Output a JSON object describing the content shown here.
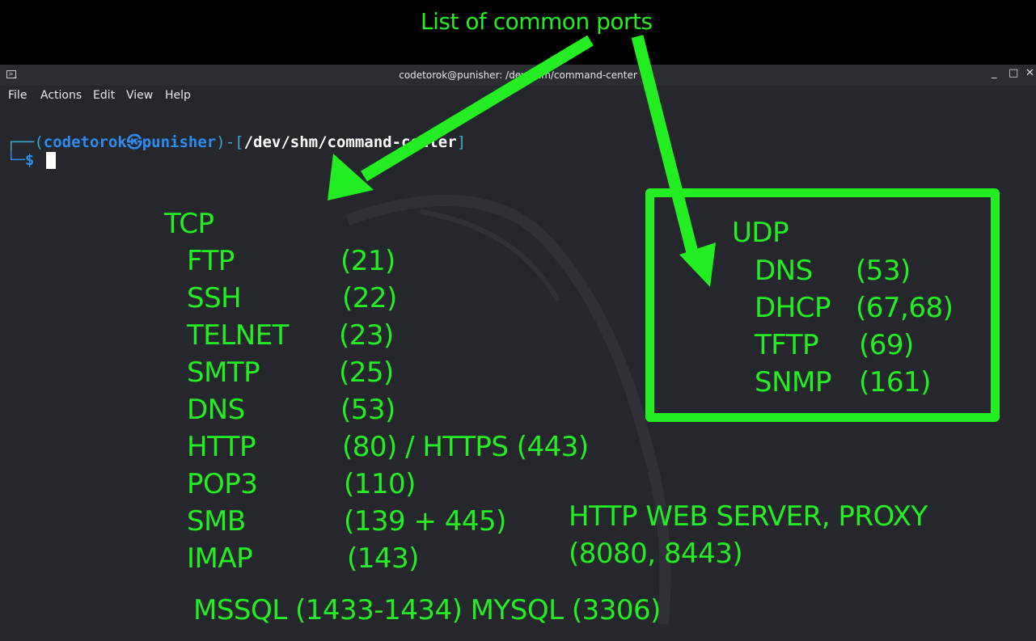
{
  "caption": "List of common ports",
  "window": {
    "title": "codetorok@punisher: /dev/shm/command-center",
    "controls": [
      "_",
      "□",
      "✕"
    ]
  },
  "menu": [
    "File",
    "Actions",
    "Edit",
    "View",
    "Help"
  ],
  "prompt": {
    "open": "┌──(",
    "user": "codetorok",
    "host_sep": "㉿",
    "host": "punisher",
    "mid": ")-[",
    "path": "/dev/shm/command-center",
    "close": "]",
    "line2": "└─$"
  },
  "tcp": {
    "heading": "TCP",
    "entries": [
      {
        "name": "FTP",
        "port": "(21)"
      },
      {
        "name": "SSH",
        "port": "(22)"
      },
      {
        "name": "TELNET",
        "port": "(23)"
      },
      {
        "name": "SMTP",
        "port": "(25)"
      },
      {
        "name": "DNS",
        "port": "(53)"
      },
      {
        "name": "HTTP",
        "port": "(80) / HTTPS (443)"
      },
      {
        "name": "POP3",
        "port": "(110)"
      },
      {
        "name": "SMB",
        "port": "(139 + 445)"
      },
      {
        "name": "IMAP",
        "port": "(143)"
      }
    ]
  },
  "udp": {
    "heading": "UDP",
    "entries": [
      {
        "name": "DNS",
        "port": "(53)"
      },
      {
        "name": "DHCP",
        "port": "(67,68)"
      },
      {
        "name": "TFTP",
        "port": "(69)"
      },
      {
        "name": "SNMP",
        "port": "(161)"
      }
    ]
  },
  "http_proxy": {
    "line1": "HTTP WEB SERVER, PROXY",
    "line2": "(8080, 8443)"
  },
  "databases": "MSSQL (1433-1434) MYSQL (3306)",
  "colors": {
    "annotation": "#22ee22",
    "terminal_bg": "#25272c",
    "prompt_user": "#2e8cf0",
    "prompt_bracket": "#3fa8c8"
  }
}
